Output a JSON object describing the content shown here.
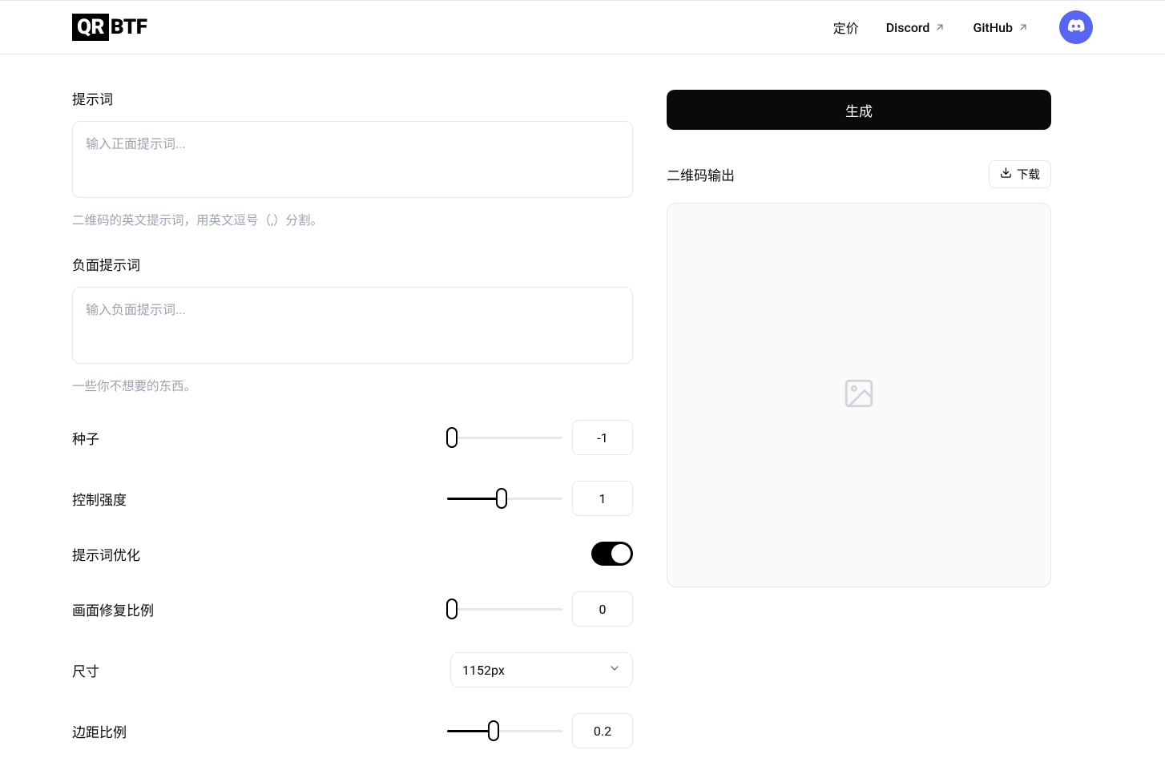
{
  "header": {
    "logo_qr": "QR",
    "logo_btf": "BTF",
    "nav": {
      "pricing": "定价",
      "discord": "Discord",
      "github": "GitHub"
    }
  },
  "form": {
    "prompt": {
      "label": "提示词",
      "placeholder": "输入正面提示词...",
      "helper": "二维码的英文提示词，用英文逗号（,）分割。"
    },
    "negative_prompt": {
      "label": "负面提示词",
      "placeholder": "输入负面提示词...",
      "helper": "一些你不想要的东西。"
    },
    "seed": {
      "label": "种子",
      "value": "-1",
      "slider_percent": 0
    },
    "control_strength": {
      "label": "控制强度",
      "value": "1",
      "slider_percent": 47
    },
    "prompt_tuning": {
      "label": "提示词优化",
      "enabled": true
    },
    "restoration_rate": {
      "label": "画面修复比例",
      "value": "0",
      "slider_percent": 0
    },
    "size": {
      "label": "尺寸",
      "value": "1152px"
    },
    "padding_ratio": {
      "label": "边距比例",
      "value": "0.2",
      "slider_percent": 40
    }
  },
  "output": {
    "generate_label": "生成",
    "title": "二维码输出",
    "download_label": "下载"
  }
}
